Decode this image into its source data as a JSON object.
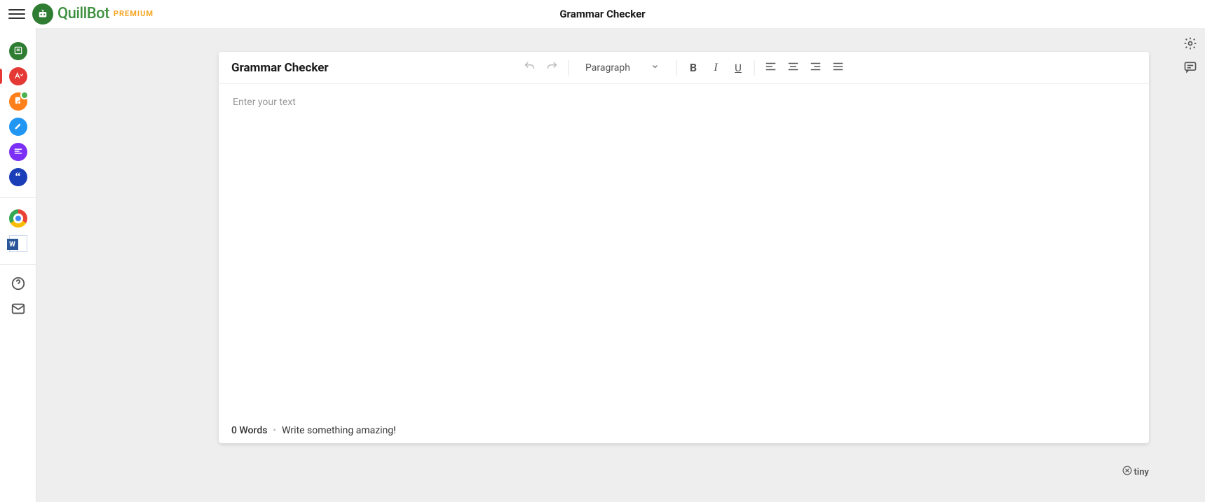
{
  "header": {
    "brand": "QuillBot",
    "premium_label": "PREMIUM",
    "page_title": "Grammar Checker"
  },
  "sidebar": {
    "tools": [
      {
        "name": "paraphraser",
        "color": "#2e7d32",
        "icon": "paraphrase"
      },
      {
        "name": "grammar-checker",
        "color": "#e53935",
        "icon": "grammar",
        "active": true
      },
      {
        "name": "plagiarism-checker",
        "color": "#ff7f1a",
        "icon": "plagiarism",
        "notif": true
      },
      {
        "name": "co-writer",
        "color": "#2196f3",
        "icon": "cowriter"
      },
      {
        "name": "summarizer",
        "color": "#7c2ff5",
        "icon": "summarizer"
      },
      {
        "name": "citation-generator",
        "color": "#1a3db8",
        "icon": "citation"
      }
    ],
    "extensions": [
      {
        "name": "chrome-extension"
      },
      {
        "name": "word-extension"
      }
    ],
    "footer": [
      {
        "name": "help"
      },
      {
        "name": "contact"
      }
    ]
  },
  "editor": {
    "title": "Grammar Checker",
    "block_format": "Paragraph",
    "placeholder": "Enter your text",
    "word_count_label": "0 Words",
    "footer_message": "Write something amazing!"
  },
  "right_rail": {
    "settings": "settings",
    "feedback": "feedback"
  },
  "powered_by": "tiny"
}
